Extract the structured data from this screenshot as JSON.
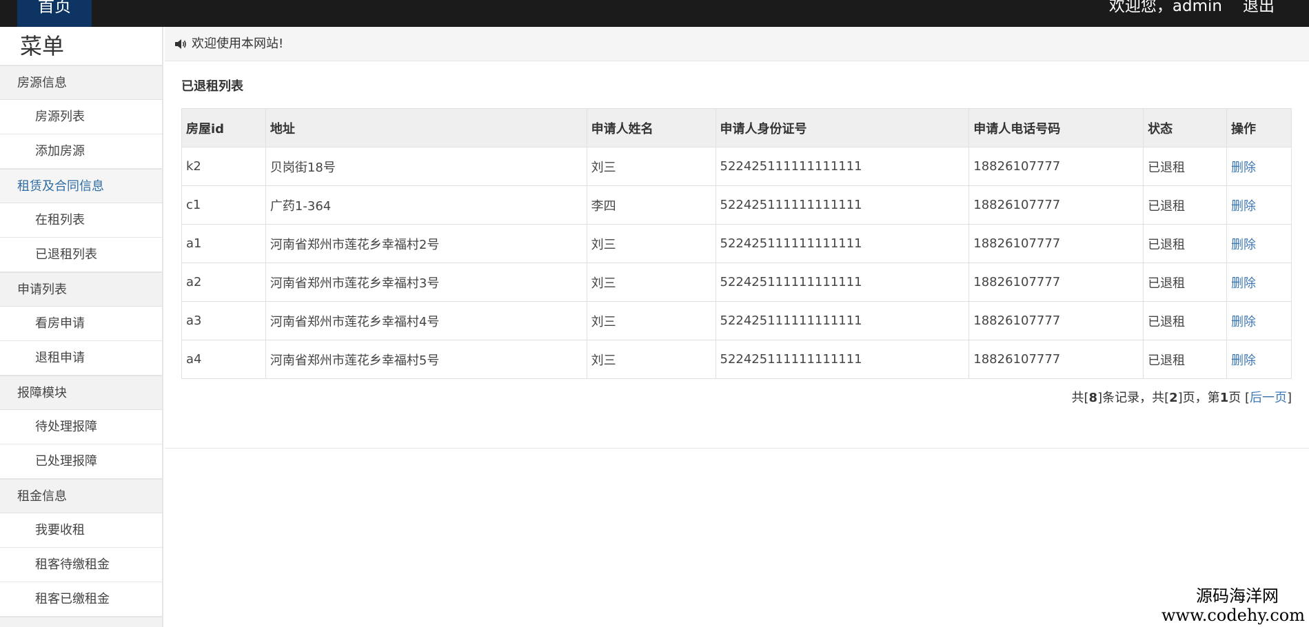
{
  "topbar": {
    "home_label": "首页",
    "welcome_user": "欢迎您，admin",
    "logout_label": "退出"
  },
  "sidebar": {
    "title": "菜单",
    "groups": [
      {
        "label": "房源信息",
        "items": [
          "房源列表",
          "添加房源"
        ]
      },
      {
        "label": "租赁及合同信息",
        "items": [
          "在租列表",
          "已退租列表"
        ]
      },
      {
        "label": "申请列表",
        "items": [
          "看房申请",
          "退租申请"
        ]
      },
      {
        "label": "报障模块",
        "items": [
          "待处理报障",
          "已处理报障"
        ]
      },
      {
        "label": "租金信息",
        "items": [
          "我要收租",
          "租客待缴租金",
          "租客已缴租金"
        ]
      }
    ]
  },
  "main": {
    "welcome_text": "欢迎使用本网站!",
    "section_title": "已退租列表",
    "table": {
      "headers": [
        "房屋id",
        "地址",
        "申请人姓名",
        "申请人身份证号",
        "申请人电话号码",
        "状态",
        "操作"
      ],
      "rows": [
        [
          "k2",
          "贝岗街18号",
          "刘三",
          "522425111111111111",
          "18826107777",
          "已退租",
          "删除"
        ],
        [
          "c1",
          "广药1-364",
          "李四",
          "522425111111111111",
          "18826107777",
          "已退租",
          "删除"
        ],
        [
          "a1",
          "河南省郑州市莲花乡幸福村2号",
          "刘三",
          "522425111111111111",
          "18826107777",
          "已退租",
          "删除"
        ],
        [
          "a2",
          "河南省郑州市莲花乡幸福村3号",
          "刘三",
          "522425111111111111",
          "18826107777",
          "已退租",
          "删除"
        ],
        [
          "a3",
          "河南省郑州市莲花乡幸福村4号",
          "刘三",
          "522425111111111111",
          "18826107777",
          "已退租",
          "删除"
        ],
        [
          "a4",
          "河南省郑州市莲花乡幸福村5号",
          "刘三",
          "522425111111111111",
          "18826107777",
          "已退租",
          "删除"
        ]
      ]
    },
    "pager": {
      "prefix": "共[",
      "total_records": "8",
      "mid1": "]条记录，共[",
      "total_pages": "2",
      "mid2": "]页，第",
      "current_page": "1",
      "mid3": "页 [",
      "next_label": "后一页",
      "suffix": "]"
    }
  },
  "watermark": {
    "line1": "源码海洋网",
    "line2": "www.codehy.com"
  },
  "colors": {
    "topbar_bg": "#1b1b1b",
    "home_tab_bg": "#0d3463",
    "link": "#3b78b4",
    "active_group": "#2f6da2"
  }
}
